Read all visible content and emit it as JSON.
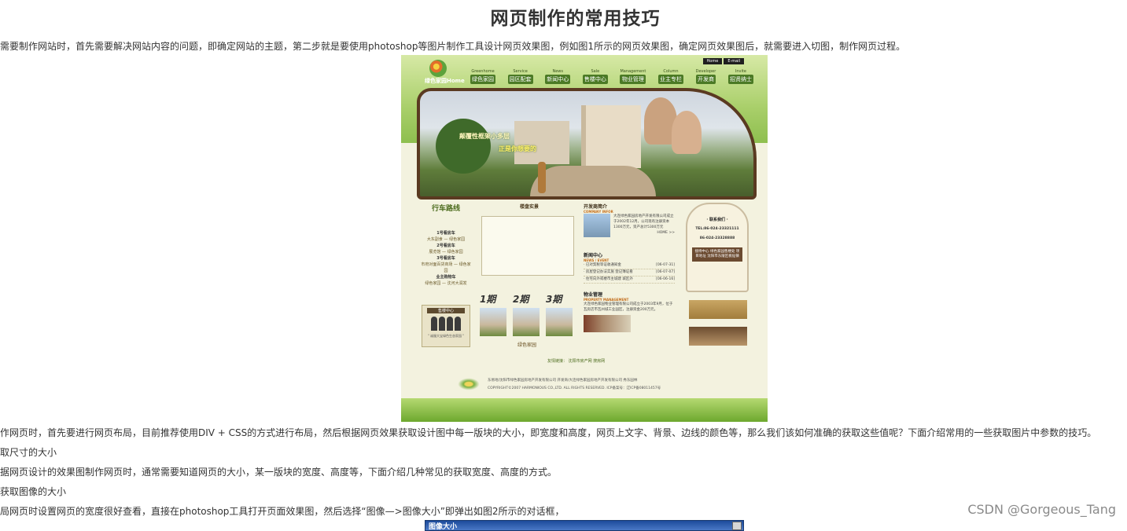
{
  "article": {
    "title": "网页制作的常用技巧",
    "paragraphs": {
      "p1": "当需要制作网站时，首先需要解决网站内容的问题，即确定网站的主题，第二步就是要使用photoshop等图片制作工具设计网页效果图，例如图1所示的网页效果图，确定网页效果图后，就需要进入切图，制作网页过程。",
      "p2": "制作网页时，首先要进行网页布局，目前推荐使用DIV + CSS的方式进行布局，然后根据网页效果获取设计图中每一版块的大小，即宽度和高度，网页上文字、背景、边线的颜色等，那么我们该如何准确的获取这些值呢？下面介绍常用的一些获取图片中参数的技巧。",
      "p3": "获取尺寸的大小",
      "p4": "根据网页设计的效果图制作网页时，通常需要知道网页的大小，某一版块的宽度、高度等，下面介绍几种常见的获取宽度、高度的方式。",
      "p5": "、获取图像的大小",
      "p6": "布局网页时设置网页的宽度很好查看，直接在photoshop工具打开页面效果图，然后选择“图像—>图像大小”即弹出如图2所示的对话框，"
    }
  },
  "figure1": {
    "top_links": [
      "Home",
      "E-mail"
    ],
    "logo_text": "绿色家园Home",
    "nav": [
      {
        "en": "Greenhome",
        "cn": "绿色家园"
      },
      {
        "en": "Service",
        "cn": "园区配套"
      },
      {
        "en": "News",
        "cn": "新闻中心"
      },
      {
        "en": "Sale",
        "cn": "售楼中心"
      },
      {
        "en": "Management",
        "cn": "物业管理"
      },
      {
        "en": "Column",
        "cn": "业主专栏"
      },
      {
        "en": "Developer",
        "cn": "开发商"
      },
      {
        "en": "Invite",
        "cn": "招贤纳士"
      }
    ],
    "banner": {
      "slogan1": "颠覆性框架小多层",
      "slogan2": "正是你想要的"
    },
    "left": {
      "heading": "行车路线",
      "lines": [
        "1号看房车",
        "大东副食 — 绿色家园",
        "2号看房车",
        "展览馆 — 绿色家园",
        "3号看房车",
        "市府对面百货商场 — 绿色家园",
        "业主购物车",
        "绿色家园 — 沈河大润发"
      ],
      "card_title": "售楼中心",
      "card_caption": "\" 诚服大宝绿色生态家园 \""
    },
    "middle": {
      "heading": "楼盘实景",
      "thumbs": [
        "1期",
        "2期",
        "3期"
      ],
      "caption": "绿色家园"
    },
    "company": {
      "heading": "开发商简介",
      "sub": "COMPANY INFOR",
      "text": "大连绿色家园房地产开发有限公司成立于2002年12月，公司现有注册资本1300万元，资产总计5300万元",
      "more": "HOME >>"
    },
    "news": {
      "heading": "新闻中心",
      "sub": "NEWS / EVENT",
      "items": [
        {
          "title": "· 已对契税等证收通知金",
          "date": "[06-07-31]"
        },
        {
          "title": "· 房屋登记办法实施 登记簿证看",
          "date": "[06-07-07]"
        },
        {
          "title": "· 住宅向外或楼市主城建 城区外",
          "date": "[06-06-16]"
        }
      ]
    },
    "property": {
      "heading": "物业管理",
      "sub": "PROPERTY MANAGEMENT",
      "text": "大连绿色家园物业管理有限公司成立于2003年9月，位于瓦房店市瓦州城工业园区，注册资金200万元。"
    },
    "contact": {
      "heading": "· 联系我们 ·",
      "tel1": "TEL:86-024-23321111",
      "tel2": "86-024-23328888",
      "dark": "接待中心 绿色家园售楼处 项目地址 沈阳市东陵区桃仙镇"
    },
    "links": "友情链接：  沈阳市房产网    搜房网",
    "footer1": "东易地/沈阳市绿色家园房地产开发有限公司   开发商/大连绿色家园房地产开发有限公司   秀东园林",
    "footer2": "COPYRIGHT©2007 HARMONIOUS CO.,LTD. ALL RIGHTS RESERVED.   ICP备案号：辽ICP备08011457号"
  },
  "figure2": {
    "title": "图像大小"
  },
  "watermark": "CSDN @Gorgeous_Tang"
}
